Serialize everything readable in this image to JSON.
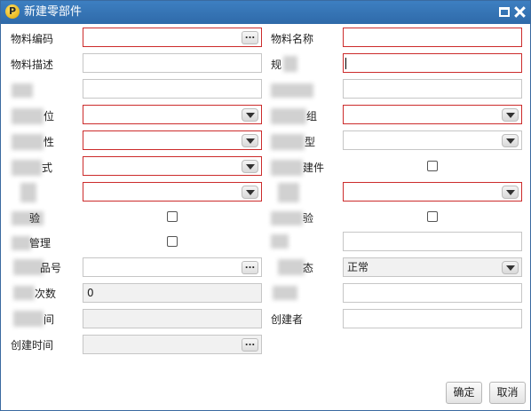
{
  "window": {
    "title": "新建零部件",
    "app_icon_glyph": "P"
  },
  "labels": {
    "material_code": "物料编码",
    "material_name": "物料名称",
    "material_desc": "物料描述",
    "spec_partial": "规",
    "unit_partial": "位",
    "group_partial": "组",
    "attr_partial": "性",
    "type_partial": "型",
    "mode_partial": "式",
    "component_partial": "建件",
    "inspection_left_partial": "验",
    "inspection_right_partial": "验",
    "management_partial": "管理",
    "product_no_partial": "品号",
    "status_partial": "态",
    "count_partial": "次数",
    "time_partial": "间",
    "creator": "创建者",
    "created_time": "创建时间"
  },
  "values": {
    "count_value": "0",
    "status_value": "正常"
  },
  "buttons": {
    "ok": "确定",
    "cancel": "取消",
    "ellipsis": "..."
  },
  "icons": {
    "app": "app-logo-icon",
    "maximize": "maximize-icon",
    "close": "close-icon",
    "dropdown": "chevron-down-icon"
  }
}
